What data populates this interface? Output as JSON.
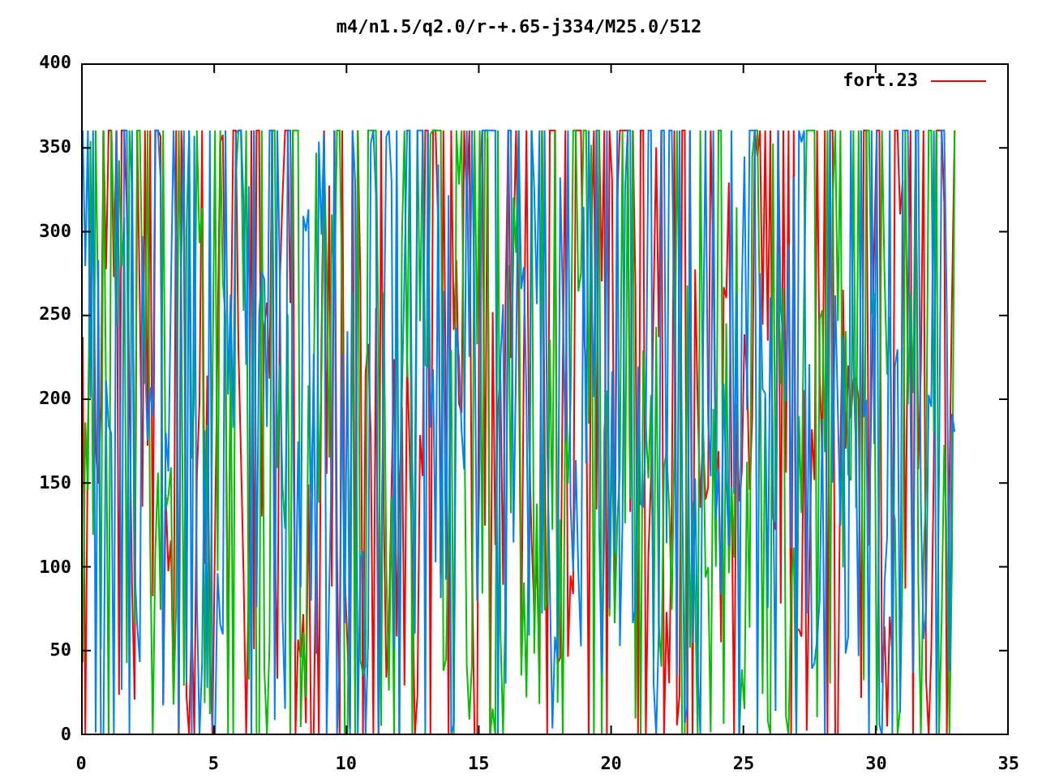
{
  "title": "m4/n1.5/q2.0/r-+.65-j334/M25.0/512",
  "legend": [
    {
      "label": "fort.23",
      "color": "#ff0000"
    }
  ],
  "y_ticks": [
    "400",
    "350",
    "300",
    "250",
    "200",
    "150",
    "100",
    "50",
    "0"
  ],
  "x_ticks": [
    "0",
    "5",
    "10",
    "15",
    "20",
    "25",
    "30",
    "35"
  ]
}
